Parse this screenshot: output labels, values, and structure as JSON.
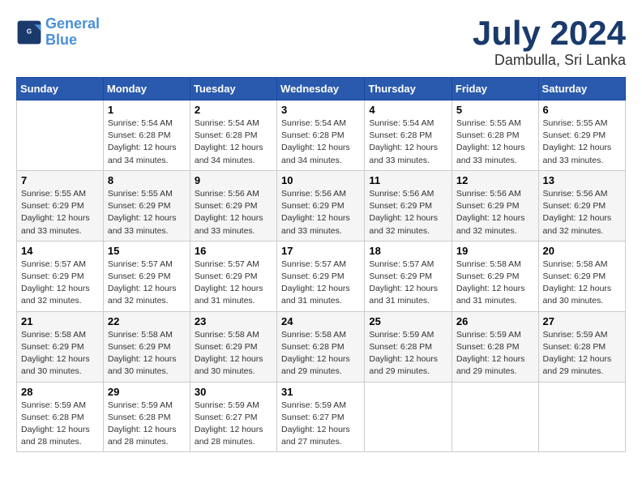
{
  "header": {
    "logo_line1": "General",
    "logo_line2": "Blue",
    "month": "July 2024",
    "location": "Dambulla, Sri Lanka"
  },
  "days_of_week": [
    "Sunday",
    "Monday",
    "Tuesday",
    "Wednesday",
    "Thursday",
    "Friday",
    "Saturday"
  ],
  "weeks": [
    [
      {
        "day": "",
        "info": ""
      },
      {
        "day": "1",
        "info": "Sunrise: 5:54 AM\nSunset: 6:28 PM\nDaylight: 12 hours\nand 34 minutes."
      },
      {
        "day": "2",
        "info": "Sunrise: 5:54 AM\nSunset: 6:28 PM\nDaylight: 12 hours\nand 34 minutes."
      },
      {
        "day": "3",
        "info": "Sunrise: 5:54 AM\nSunset: 6:28 PM\nDaylight: 12 hours\nand 34 minutes."
      },
      {
        "day": "4",
        "info": "Sunrise: 5:54 AM\nSunset: 6:28 PM\nDaylight: 12 hours\nand 33 minutes."
      },
      {
        "day": "5",
        "info": "Sunrise: 5:55 AM\nSunset: 6:28 PM\nDaylight: 12 hours\nand 33 minutes."
      },
      {
        "day": "6",
        "info": "Sunrise: 5:55 AM\nSunset: 6:29 PM\nDaylight: 12 hours\nand 33 minutes."
      }
    ],
    [
      {
        "day": "7",
        "info": ""
      },
      {
        "day": "8",
        "info": "Sunrise: 5:55 AM\nSunset: 6:29 PM\nDaylight: 12 hours\nand 33 minutes."
      },
      {
        "day": "9",
        "info": "Sunrise: 5:56 AM\nSunset: 6:29 PM\nDaylight: 12 hours\nand 33 minutes."
      },
      {
        "day": "10",
        "info": "Sunrise: 5:56 AM\nSunset: 6:29 PM\nDaylight: 12 hours\nand 33 minutes."
      },
      {
        "day": "11",
        "info": "Sunrise: 5:56 AM\nSunset: 6:29 PM\nDaylight: 12 hours\nand 32 minutes."
      },
      {
        "day": "12",
        "info": "Sunrise: 5:56 AM\nSunset: 6:29 PM\nDaylight: 12 hours\nand 32 minutes."
      },
      {
        "day": "13",
        "info": "Sunrise: 5:56 AM\nSunset: 6:29 PM\nDaylight: 12 hours\nand 32 minutes."
      }
    ],
    [
      {
        "day": "14",
        "info": ""
      },
      {
        "day": "15",
        "info": "Sunrise: 5:57 AM\nSunset: 6:29 PM\nDaylight: 12 hours\nand 32 minutes."
      },
      {
        "day": "16",
        "info": "Sunrise: 5:57 AM\nSunset: 6:29 PM\nDaylight: 12 hours\nand 31 minutes."
      },
      {
        "day": "17",
        "info": "Sunrise: 5:57 AM\nSunset: 6:29 PM\nDaylight: 12 hours\nand 31 minutes."
      },
      {
        "day": "18",
        "info": "Sunrise: 5:57 AM\nSunset: 6:29 PM\nDaylight: 12 hours\nand 31 minutes."
      },
      {
        "day": "19",
        "info": "Sunrise: 5:58 AM\nSunset: 6:29 PM\nDaylight: 12 hours\nand 31 minutes."
      },
      {
        "day": "20",
        "info": "Sunrise: 5:58 AM\nSunset: 6:29 PM\nDaylight: 12 hours\nand 30 minutes."
      }
    ],
    [
      {
        "day": "21",
        "info": ""
      },
      {
        "day": "22",
        "info": "Sunrise: 5:58 AM\nSunset: 6:29 PM\nDaylight: 12 hours\nand 30 minutes."
      },
      {
        "day": "23",
        "info": "Sunrise: 5:58 AM\nSunset: 6:29 PM\nDaylight: 12 hours\nand 30 minutes."
      },
      {
        "day": "24",
        "info": "Sunrise: 5:58 AM\nSunset: 6:28 PM\nDaylight: 12 hours\nand 29 minutes."
      },
      {
        "day": "25",
        "info": "Sunrise: 5:59 AM\nSunset: 6:28 PM\nDaylight: 12 hours\nand 29 minutes."
      },
      {
        "day": "26",
        "info": "Sunrise: 5:59 AM\nSunset: 6:28 PM\nDaylight: 12 hours\nand 29 minutes."
      },
      {
        "day": "27",
        "info": "Sunrise: 5:59 AM\nSunset: 6:28 PM\nDaylight: 12 hours\nand 29 minutes."
      }
    ],
    [
      {
        "day": "28",
        "info": "Sunrise: 5:59 AM\nSunset: 6:28 PM\nDaylight: 12 hours\nand 28 minutes."
      },
      {
        "day": "29",
        "info": "Sunrise: 5:59 AM\nSunset: 6:28 PM\nDaylight: 12 hours\nand 28 minutes."
      },
      {
        "day": "30",
        "info": "Sunrise: 5:59 AM\nSunset: 6:27 PM\nDaylight: 12 hours\nand 28 minutes."
      },
      {
        "day": "31",
        "info": "Sunrise: 5:59 AM\nSunset: 6:27 PM\nDaylight: 12 hours\nand 27 minutes."
      },
      {
        "day": "",
        "info": ""
      },
      {
        "day": "",
        "info": ""
      },
      {
        "day": "",
        "info": ""
      }
    ]
  ],
  "week2_day7_info": "Sunrise: 5:55 AM\nSunset: 6:29 PM\nDaylight: 12 hours\nand 33 minutes.",
  "week3_day14_info": "Sunrise: 5:57 AM\nSunset: 6:29 PM\nDaylight: 12 hours\nand 32 minutes.",
  "week4_day21_info": "Sunrise: 5:58 AM\nSunset: 6:29 PM\nDaylight: 12 hours\nand 30 minutes."
}
